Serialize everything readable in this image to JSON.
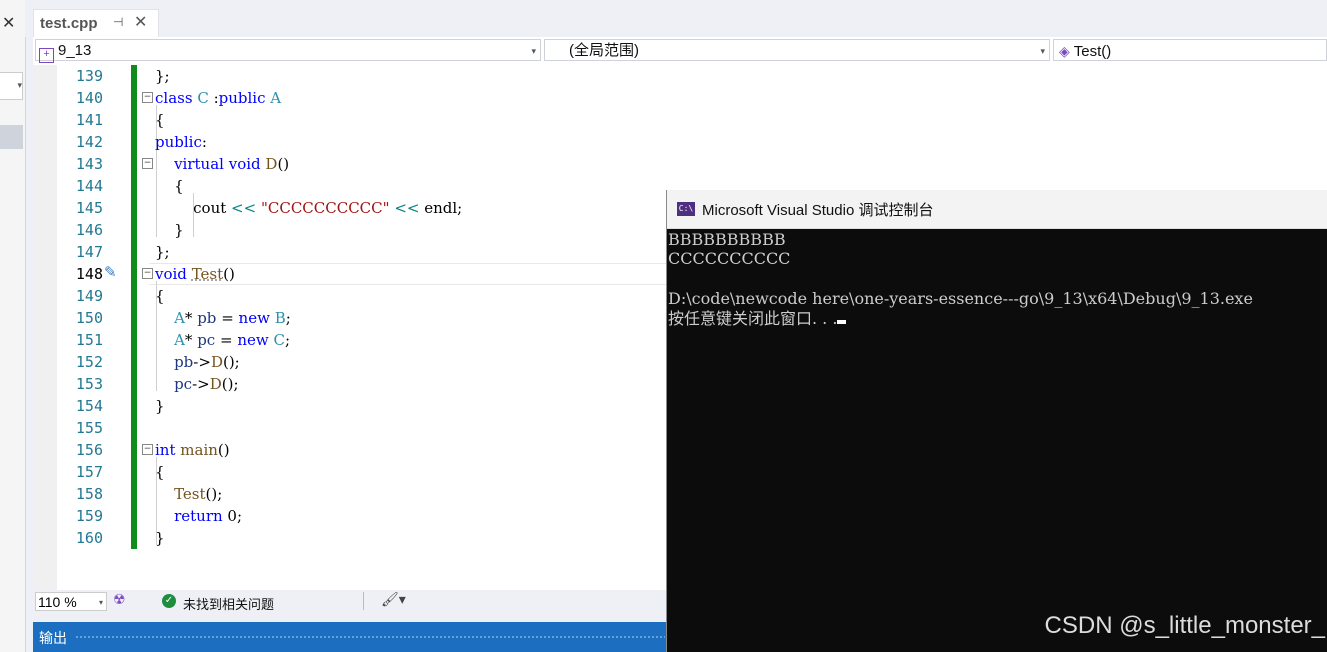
{
  "left_panel": {
    "close_glyph": "✕",
    "dropdown_glyph": "▾"
  },
  "tab": {
    "title": "test.cpp",
    "pin_glyph": "⊣",
    "close_glyph": "✕"
  },
  "navbar": {
    "project": "9_13",
    "scope": "(全局范围)",
    "member": "Test()",
    "arrow": "▾"
  },
  "editor": {
    "lines": [
      {
        "n": "139"
      },
      {
        "n": "140"
      },
      {
        "n": "141"
      },
      {
        "n": "142"
      },
      {
        "n": "143"
      },
      {
        "n": "144"
      },
      {
        "n": "145"
      },
      {
        "n": "146"
      },
      {
        "n": "147"
      },
      {
        "n": "148"
      },
      {
        "n": "149"
      },
      {
        "n": "150"
      },
      {
        "n": "151"
      },
      {
        "n": "152"
      },
      {
        "n": "153"
      },
      {
        "n": "154"
      },
      {
        "n": "155"
      },
      {
        "n": "156"
      },
      {
        "n": "157"
      },
      {
        "n": "158"
      },
      {
        "n": "159"
      },
      {
        "n": "160"
      }
    ],
    "fold_glyph": "−"
  },
  "status": {
    "zoom": "110 %",
    "issues": "未找到相关问题",
    "check_glyph": "✓",
    "brush_glyph": "🖌▾"
  },
  "output": {
    "label": "输出"
  },
  "console": {
    "icon_text": "C:\\",
    "title": "Microsoft Visual Studio 调试控制台",
    "lines": [
      "BBBBBBBBBB",
      "CCCCCCCCCC",
      "",
      "D:\\code\\newcode here\\one-years-essence---go\\9_13\\x64\\Debug\\9_13.exe",
      "按任意键关闭此窗口. . ."
    ]
  },
  "watermark": "CSDN @s_little_monster_"
}
